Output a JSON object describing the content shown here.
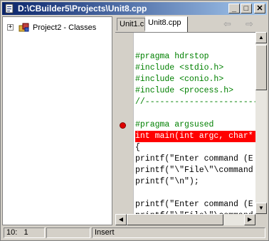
{
  "window": {
    "title": "D:\\CBuilder5\\Projects\\Unit8.cpp",
    "controls": {
      "minimize": "_",
      "maximize": "□",
      "close": "✕"
    }
  },
  "tree": {
    "expander": "+",
    "items": [
      {
        "label": "Project2 - Classes"
      }
    ]
  },
  "tabs": [
    {
      "label": "Unit1.c",
      "active": false
    },
    {
      "label": "Unit8.cpp",
      "active": true
    }
  ],
  "nav": {
    "back": "⇦",
    "forward": "⇨"
  },
  "code": {
    "lines": [
      {
        "text": "",
        "kind": "blank"
      },
      {
        "text": "#pragma hdrstop",
        "kind": "directive"
      },
      {
        "text": "#include <stdio.h>",
        "kind": "directive"
      },
      {
        "text": "#include <conio.h>",
        "kind": "directive"
      },
      {
        "text": "#include <process.h>",
        "kind": "directive"
      },
      {
        "text": "//-------------------------------",
        "kind": "directive"
      },
      {
        "text": "",
        "kind": "blank"
      },
      {
        "text": "#pragma argsused",
        "kind": "directive"
      },
      {
        "text": "int main(int argc, char* argv[])",
        "kind": "breakpoint"
      },
      {
        "text": "{",
        "kind": "normal"
      },
      {
        "text": "printf(\"Enter command (E",
        "kind": "normal"
      },
      {
        "text": "printf(\"\\\"File\\\"\\command",
        "kind": "normal"
      },
      {
        "text": "printf(\"\\n\");",
        "kind": "normal"
      },
      {
        "text": "",
        "kind": "blank"
      },
      {
        "text": "printf(\"Enter command (E",
        "kind": "normal"
      },
      {
        "text": "printf(\"\\\"File\\\"\\command",
        "kind": "normal"
      },
      {
        "text": "printf(\"\\n\");",
        "kind": "normal"
      }
    ]
  },
  "statusbar": {
    "position": "10:   1",
    "modified": "",
    "mode": "Insert"
  },
  "colors": {
    "titlebar_start": "#0a246a",
    "titlebar_end": "#a6caf0",
    "directive": "#008000",
    "breakpoint_line": "#ff0000",
    "breakpoint_dot": "#e00000"
  },
  "icons": {
    "title": "cpp-file-icon",
    "tree": "project-icon",
    "breakpoint": "breakpoint-dot-icon"
  }
}
